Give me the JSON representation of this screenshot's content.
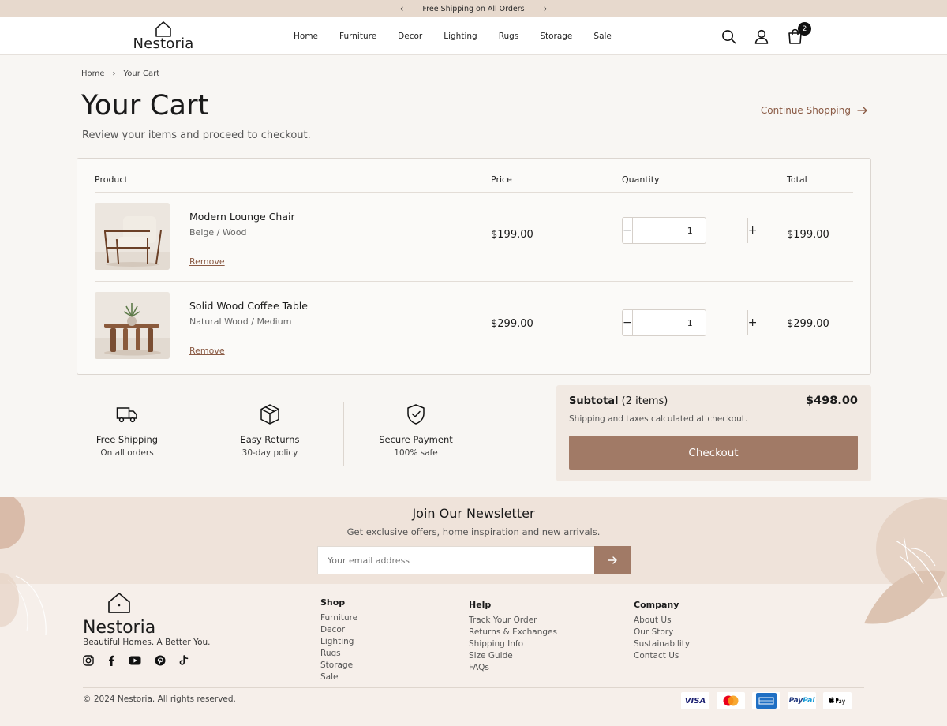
{
  "announcement": {
    "text": "Free Shipping on All Orders",
    "prev": "‹",
    "next": "›"
  },
  "header": {
    "brand": "Nestoria",
    "nav": [
      "Home",
      "Furniture",
      "Decor",
      "Lighting",
      "Rugs",
      "Storage",
      "Sale"
    ],
    "cart_count": "2",
    "icons": [
      "search-icon",
      "user-icon",
      "shopping-bag-icon"
    ]
  },
  "breadcrumb": {
    "home": "Home",
    "separator": "›",
    "current": "Your Cart"
  },
  "page": {
    "title": "Your Cart",
    "subtitle": "Review your items and proceed to checkout.",
    "continue_label": "Continue Shopping"
  },
  "table": {
    "headers": {
      "product": "Product",
      "price": "Price",
      "quantity": "Quantity",
      "total": "Total"
    },
    "items": [
      {
        "name": "Modern Lounge Chair",
        "variant": "Beige  /  Wood",
        "price": "$199.00",
        "quantity": "1",
        "total": "$199.00",
        "remove": "Remove"
      },
      {
        "name": "Solid Wood Coffee Table",
        "variant": "Natural Wood  /  Medium",
        "price": "$299.00",
        "quantity": "1",
        "total": "$299.00",
        "remove": "Remove"
      }
    ],
    "minus": "−",
    "plus": "+"
  },
  "features": [
    {
      "title": "Free Shipping",
      "subtitle": "On all orders",
      "icon": "truck-icon"
    },
    {
      "title": "Easy Returns",
      "subtitle": "30-day policy",
      "icon": "box-icon"
    },
    {
      "title": "Secure Payment",
      "subtitle": "100% safe",
      "icon": "shield-check-icon"
    }
  ],
  "summary": {
    "label": "Subtotal",
    "count": "(2 items)",
    "total": "$498.00",
    "note": "Shipping and taxes calculated at checkout.",
    "checkout": "Checkout"
  },
  "newsletter": {
    "title": "Join Our Newsletter",
    "subtitle": "Get exclusive offers, home inspiration and new arrivals.",
    "placeholder": "Your email address"
  },
  "footer": {
    "brand": "Nestoria",
    "tagline": "Beautiful Homes. A Better You.",
    "social": [
      "instagram-icon",
      "facebook-icon",
      "youtube-icon",
      "pinterest-icon",
      "tiktok-icon"
    ],
    "shop": {
      "title": "Shop",
      "links": [
        "Furniture",
        "Decor",
        "Lighting",
        "Rugs",
        "Storage",
        "Sale"
      ]
    },
    "help": {
      "title": "Help",
      "links": [
        "Track Your Order",
        "Returns & Exchanges",
        "Shipping Info",
        "Size Guide",
        "FAQs"
      ]
    },
    "company": {
      "title": "Company",
      "links": [
        "About Us",
        "Our Story",
        "Sustainability",
        "Contact Us"
      ]
    },
    "copyright": "© 2024 Nestoria. All rights reserved.",
    "payments": [
      "VISA",
      "Mastercard",
      "American Express",
      "PayPal",
      "Apple Pay"
    ]
  },
  "colors": {
    "accent": "#a17a66",
    "link": "#8a5a44",
    "announce_bg": "#e7d9cd",
    "summary_bg": "#f1e9e2"
  }
}
